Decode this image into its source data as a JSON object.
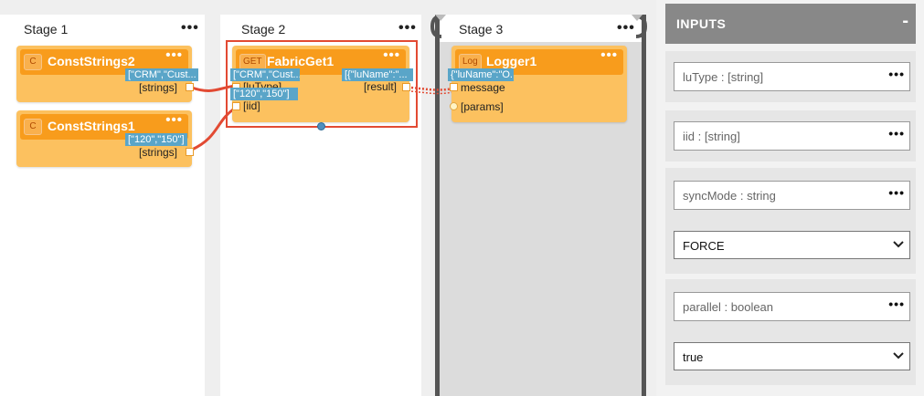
{
  "stages": [
    {
      "title": "Stage 1"
    },
    {
      "title": "Stage 2"
    },
    {
      "title": "Stage 3"
    }
  ],
  "stage_menu_icon": "more-horizontal-icon",
  "actors": {
    "const_strings2": {
      "badge": "C",
      "name": "ConstStrings2",
      "value_pill": "[\"CRM\",\"Cust...",
      "output_label": "[strings]"
    },
    "const_strings1": {
      "badge": "C",
      "name": "ConstStrings1",
      "value_pill": "[\"120\",\"150\"]",
      "output_label": "[strings]"
    },
    "fabric_get1": {
      "badge": "GET",
      "name": "FabricGet1",
      "input1_pill": "[\"CRM\",\"Cust...",
      "input1_label": "[luType]",
      "input2_pill": "[\"120\",\"150\"]",
      "input2_label": "[iid]",
      "output_pill": "[{\"luName\":\"...",
      "output_label": "[result]"
    },
    "logger1": {
      "badge": "Log",
      "name": "Logger1",
      "input_pill": "{\"luName\":\"O...",
      "input1_label": "message",
      "input2_label": "[params]"
    }
  },
  "panel": {
    "title": "INPUTS",
    "collapse_label": "-",
    "fields": [
      {
        "label": "luType : [string]"
      },
      {
        "label": "iid : [string]"
      },
      {
        "label": "syncMode : string",
        "select_value": "FORCE"
      },
      {
        "label": "parallel : boolean",
        "select_value": "true"
      }
    ]
  },
  "colors": {
    "actor_body": "#fcc15f",
    "actor_header": "#f89c1c",
    "pill": "#5aa5c8",
    "link": "#e24a33",
    "panel_header": "#888888"
  }
}
